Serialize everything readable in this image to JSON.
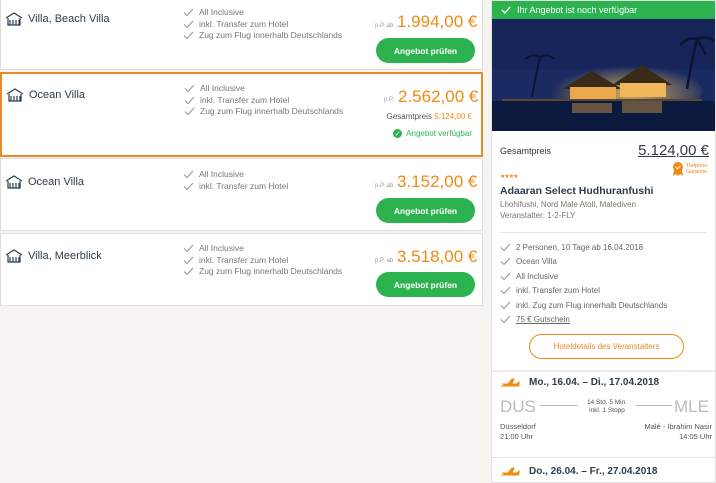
{
  "offers": [
    {
      "room": "Villa, Beach Villa",
      "features": [
        "All Inclusive",
        "inkl. Transfer zum Hotel",
        "Zug zum Flug innerhalb Deutschlands"
      ],
      "pp": "p.P. ab",
      "price": "1.994,00 €",
      "button": "Angebot prüfen"
    },
    {
      "room": "Ocean Villa",
      "features": [
        "All Inclusive",
        "inkl. Transfer zum Hotel",
        "Zug zum Flug innerhalb Deutschlands"
      ],
      "pp": "p.P.",
      "price": "2.562,00 €",
      "total_label": "Gesamtpreis",
      "total_value": "5.124,00 €",
      "available": "Angebot verfügbar"
    },
    {
      "room": "Ocean Villa",
      "features": [
        "All Inclusive",
        "inkl. Transfer zum Hotel"
      ],
      "pp": "p.P. ab",
      "price": "3.152,00 €",
      "button": "Angebot prüfen"
    },
    {
      "room": "Villa, Meerblick",
      "features": [
        "All Inclusive",
        "inkl. Transfer zum Hotel",
        "Zug zum Flug innerhalb Deutschlands"
      ],
      "pp": "p.P. ab",
      "price": "3.518,00 €",
      "button": "Angebot prüfen"
    }
  ],
  "side": {
    "banner": "Ihr Angebot ist noch verfügbar",
    "total_label": "Gesamtpreis",
    "total_price": "5.124,00 €",
    "badge": "Tiefpreis-Garantie",
    "stars": "★★★★",
    "hotel_name": "Adaaran Select Hudhuranfushi",
    "location": "Lhohifushi, Nord Male Atoll, Malediven",
    "operator": "Veranstalter: 1-2-FLY",
    "features": [
      "2 Personen, 10 Tage ab 16.04.2018",
      "Ocean Villa",
      "All Inclusive",
      "inkl. Transfer zum Hotel",
      "inkl. Zug zum Flug innerhalb Deutschlands"
    ],
    "voucher": "75 € Gutschein",
    "details_button": "Hoteldetails des Veranstalters",
    "flight_out": {
      "date": "Mo., 16.04. – Di., 17.04.2018",
      "from": "DUS",
      "to": "MLE",
      "duration": "14 Std. 5 Min.",
      "stops": "inkl. 1 Stopp",
      "from_city": "Düsseldorf",
      "from_time": "21:00 Uhr",
      "to_city": "Malé - Ibrahim Nasir",
      "to_time": "14:05 Uhr"
    },
    "flight_back": {
      "date": "Do., 26.04. – Fr., 27.04.2018"
    }
  },
  "colors": {
    "accent": "#f08a12",
    "green": "#2cb34f",
    "navy": "#2d3c4c"
  }
}
